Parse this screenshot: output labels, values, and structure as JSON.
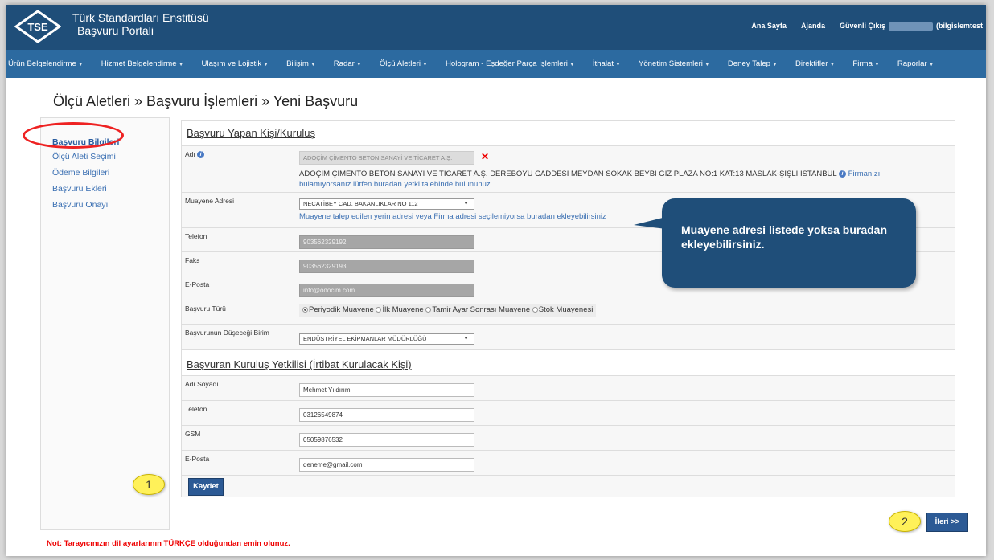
{
  "header": {
    "logo_text": "TSE",
    "brand_line1": "Türk Standardları Enstitüsü",
    "brand_line2": "Başvuru Portali",
    "links": [
      "Ana Sayfa",
      "Ajanda",
      "Güvenli Çıkış"
    ],
    "user_suffix": "(bilgislemtest"
  },
  "nav": [
    "Ürün Belgelendirme",
    "Hizmet Belgelendirme",
    "Ulaşım ve Lojistik",
    "Bilişim",
    "Radar",
    "Ölçü Aletleri",
    "Hologram - Eşdeğer Parça İşlemleri",
    "İthalat",
    "Yönetim Sistemleri",
    "Deney Talep",
    "Direktifler",
    "Firma",
    "Raporlar"
  ],
  "page_title": "Ölçü Aletleri » Başvuru İşlemleri » Yeni Başvuru",
  "sidebar": [
    "Başvuru Bilgileri",
    "Ölçü Aleti Seçimi",
    "Ödeme Bilgileri",
    "Başvuru Ekleri",
    "Başvuru Onayı"
  ],
  "form": {
    "section1": "Başvuru Yapan Kişi/Kuruluş",
    "adi_label": "Adı",
    "adi_value": "ADOÇİM ÇİMENTO BETON SANAYİ VE TİCARET A.Ş.",
    "adi_address": "ADOÇİM ÇİMENTO BETON SANAYİ VE TİCARET A.Ş. DEREBOYU CADDESİ MEYDAN SOKAK BEYBİ GİZ PLAZA NO:1 KAT:13 MASLAK-ŞİŞLİ İSTANBUL",
    "adi_link1": "Firmanızı",
    "adi_link2": "bulamıyorsanız lütfen buradan yetki talebinde bulununuz",
    "muayene_label": "Muayene Adresi",
    "muayene_value": "NECATİBEY CAD. BAKANLIKLAR NO 112",
    "muayene_link": "Muayene talep edilen yerin adresi veya Firma adresi seçilemiyorsa buradan ekleyebilirsiniz",
    "telefon_label": "Telefon",
    "telefon_value": "903562329192",
    "faks_label": "Faks",
    "faks_value": "903562329193",
    "eposta_label": "E-Posta",
    "eposta_value": "info@odocim.com",
    "tur_label": "Başvuru Türü",
    "tur_options": [
      "Periyodik Muayene",
      "İlk Muayene",
      "Tamir Ayar Sonrası Muayene",
      "Stok Muayenesi"
    ],
    "birim_label": "Başvurunun Düşeceği Birim",
    "birim_value": "ENDÜSTRİYEL EKİPMANLAR MÜDÜRLÜĞÜ",
    "section2": "Başvuran Kuruluş Yetkilisi (İrtibat Kurulacak Kişi)",
    "adsoyad_label": "Adı Soyadı",
    "adsoyad_value": "Mehmet Yıldırım",
    "tel2_label": "Telefon",
    "tel2_value": "03126549874",
    "gsm_label": "GSM",
    "gsm_value": "05059876532",
    "eposta2_label": "E-Posta",
    "eposta2_value": "deneme@gmail.com",
    "save_label": "Kaydet"
  },
  "callout": "Muayene adresi listede yoksa buradan ekleyebilirsiniz.",
  "markers": [
    "1",
    "2"
  ],
  "next_label": "İleri >>",
  "note": "Not: Tarayıcınızın dil ayarlarının TÜRKÇE olduğundan emin olunuz.",
  "colors": {
    "header": "#1f4e79",
    "nav": "#2c6aa0",
    "accent_red": "#e22222",
    "marker_yellow": "#fff159"
  }
}
